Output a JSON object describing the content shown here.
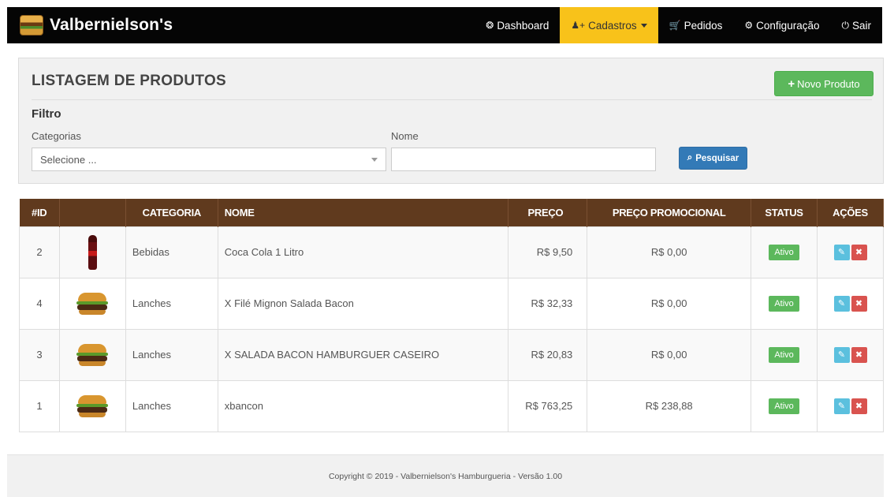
{
  "brand": {
    "name": "Valbernielson's",
    "logo_icon": "burger-logo-icon"
  },
  "nav": {
    "items": [
      {
        "label": "Dashboard",
        "icon": "tachometer-icon",
        "glyph": "❂",
        "active": false
      },
      {
        "label": "Cadastros",
        "icon": "user-plus-icon",
        "glyph": "♟+",
        "active": true
      },
      {
        "label": "Pedidos",
        "icon": "cart-icon",
        "glyph": "🛒",
        "active": false
      },
      {
        "label": "Configuração",
        "icon": "gear-icon",
        "glyph": "⚙",
        "active": false
      },
      {
        "label": "Sair",
        "icon": "power-icon",
        "glyph": "⏻",
        "active": false
      }
    ],
    "active_color": "#f8c21a"
  },
  "panel": {
    "title": "LISTAGEM DE PRODUTOS",
    "new_button_label": "Novo Produto",
    "new_button_glyph": "+",
    "filter_title": "Filtro",
    "categories_label": "Categorias",
    "categories_selected": "Selecione ...",
    "name_label": "Nome",
    "name_value": "",
    "search_button_label": "Pesquisar",
    "search_button_glyph": "⌕"
  },
  "table": {
    "headers": [
      "#ID",
      "",
      "CATEGORIA",
      "NOME",
      "PREÇO",
      "PREÇO PROMOCIONAL",
      "STATUS",
      "AÇÕES"
    ],
    "header_color": "#603a1e",
    "rows": [
      {
        "id": "2",
        "image": "coca-cola-bottle",
        "categoria": "Bebidas",
        "nome": "Coca Cola 1 Litro",
        "preco": "R$ 9,50",
        "promo": "R$ 0,00",
        "status": "Ativo"
      },
      {
        "id": "4",
        "image": "burger",
        "categoria": "Lanches",
        "nome": "X Filé Mignon Salada Bacon",
        "preco": "R$ 32,33",
        "promo": "R$ 0,00",
        "status": "Ativo"
      },
      {
        "id": "3",
        "image": "burger",
        "categoria": "Lanches",
        "nome": "X SALADA BACON HAMBURGUER CASEIRO",
        "preco": "R$ 20,83",
        "promo": "R$ 0,00",
        "status": "Ativo"
      },
      {
        "id": "1",
        "image": "burger",
        "categoria": "Lanches",
        "nome": "xbancon",
        "preco": "R$ 763,25",
        "promo": "R$ 238,88",
        "status": "Ativo"
      }
    ],
    "edit_glyph": "✎",
    "delete_glyph": "✖"
  },
  "footer": {
    "text": "Copyright © 2019 - Valbernielson's Hamburgueria - Versão 1.00"
  }
}
